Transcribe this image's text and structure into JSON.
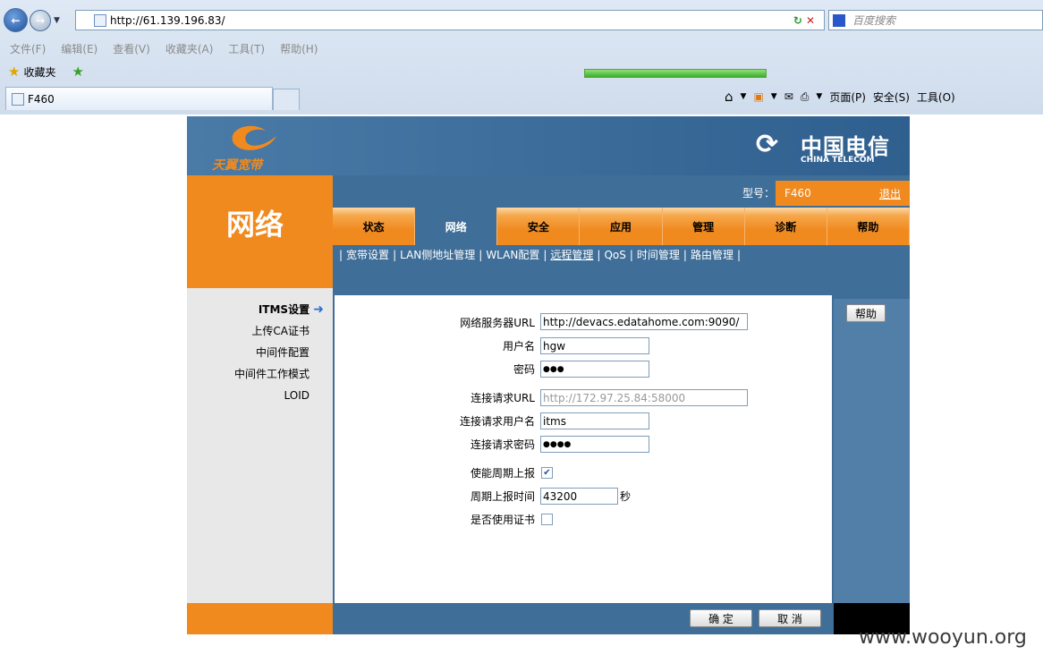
{
  "browser": {
    "address": "http://61.139.196.83/",
    "search_placeholder": "百度搜索",
    "menu": [
      "文件(F)",
      "编辑(E)",
      "查看(V)",
      "收藏夹(A)",
      "工具(T)",
      "帮助(H)"
    ],
    "favorites_label": "收藏夹",
    "tab_title": "F460",
    "commands": [
      "页面(P)",
      "安全(S)",
      "工具(O)"
    ]
  },
  "router": {
    "brand_left": "天翼宽带",
    "brand_right_cn": "中国电信",
    "brand_right_en": "CHINA TELECOM",
    "section_title": "网络",
    "model_label": "型号：",
    "model_value": "F460",
    "logout": "退出",
    "tabs": [
      "状态",
      "网络",
      "安全",
      "应用",
      "管理",
      "诊断",
      "帮助"
    ],
    "active_tab": "网络",
    "subnav": [
      "宽带设置",
      "LAN侧地址管理",
      "WLAN配置",
      "远程管理",
      "QoS",
      "时间管理",
      "路由管理"
    ],
    "active_subnav": "远程管理",
    "sidebar": [
      "ITMS设置",
      "上传CA证书",
      "中间件配置",
      "中间件工作模式",
      "LOID"
    ],
    "active_sidebar": "ITMS设置",
    "help_button": "帮助",
    "form": {
      "acs_url_label": "网络服务器URL",
      "acs_url": "http://devacs.edatahome.com:9090/",
      "username_label": "用户名",
      "username": "hgw",
      "password_label": "密码",
      "password_mask": "●●●",
      "conn_url_label": "连接请求URL",
      "conn_url": "http://172.97.25.84:58000",
      "conn_user_label": "连接请求用户名",
      "conn_user": "itms",
      "conn_pass_label": "连接请求密码",
      "conn_pass_mask": "●●●●",
      "periodic_label": "使能周期上报",
      "periodic_checked": true,
      "interval_label": "周期上报时间",
      "interval": "43200",
      "interval_unit": "秒",
      "use_cert_label": "是否使用证书",
      "use_cert_checked": false
    },
    "ok_button": "确 定",
    "cancel_button": "取 消"
  },
  "watermark": "www.wooyun.org",
  "colors": {
    "orange": "#f08a1e",
    "blue": "#3f6e98"
  }
}
